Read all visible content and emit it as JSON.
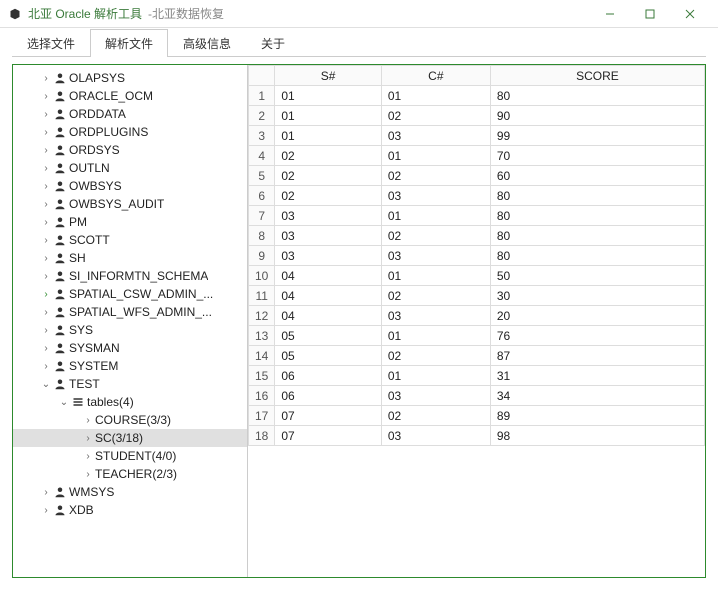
{
  "window": {
    "title": "北亚 Oracle 解析工具",
    "subtitle": "-北亚数据恢复"
  },
  "tabs": [
    {
      "label": "选择文件",
      "active": false
    },
    {
      "label": "解析文件",
      "active": true
    },
    {
      "label": "高级信息",
      "active": false
    },
    {
      "label": "关于",
      "active": false
    }
  ],
  "tree": [
    {
      "level": 1,
      "kind": "user",
      "expanded": false,
      "label": "OLAPSYS"
    },
    {
      "level": 1,
      "kind": "user",
      "expanded": false,
      "label": "ORACLE_OCM"
    },
    {
      "level": 1,
      "kind": "user",
      "expanded": false,
      "label": "ORDDATA"
    },
    {
      "level": 1,
      "kind": "user",
      "expanded": false,
      "label": "ORDPLUGINS"
    },
    {
      "level": 1,
      "kind": "user",
      "expanded": false,
      "label": "ORDSYS"
    },
    {
      "level": 1,
      "kind": "user",
      "expanded": false,
      "label": "OUTLN"
    },
    {
      "level": 1,
      "kind": "user",
      "expanded": false,
      "label": "OWBSYS"
    },
    {
      "level": 1,
      "kind": "user",
      "expanded": false,
      "label": "OWBSYS_AUDIT"
    },
    {
      "level": 1,
      "kind": "user",
      "expanded": false,
      "label": "PM"
    },
    {
      "level": 1,
      "kind": "user",
      "expanded": false,
      "label": "SCOTT"
    },
    {
      "level": 1,
      "kind": "user",
      "expanded": false,
      "label": "SH"
    },
    {
      "level": 1,
      "kind": "user",
      "expanded": false,
      "label": "SI_INFORMTN_SCHEMA"
    },
    {
      "level": 1,
      "kind": "user",
      "expanded": false,
      "label": "SPATIAL_CSW_ADMIN_...",
      "highlight": true
    },
    {
      "level": 1,
      "kind": "user",
      "expanded": false,
      "label": "SPATIAL_WFS_ADMIN_..."
    },
    {
      "level": 1,
      "kind": "user",
      "expanded": false,
      "label": "SYS"
    },
    {
      "level": 1,
      "kind": "user",
      "expanded": false,
      "label": "SYSMAN"
    },
    {
      "level": 1,
      "kind": "user",
      "expanded": false,
      "label": "SYSTEM"
    },
    {
      "level": 1,
      "kind": "user",
      "expanded": true,
      "label": "TEST"
    },
    {
      "level": 2,
      "kind": "tables",
      "expanded": true,
      "label": "tables(4)"
    },
    {
      "level": 3,
      "kind": "table",
      "expanded": false,
      "label": "COURSE(3/3)"
    },
    {
      "level": 3,
      "kind": "table",
      "expanded": false,
      "label": "SC(3/18)",
      "selected": true
    },
    {
      "level": 3,
      "kind": "table",
      "expanded": false,
      "label": "STUDENT(4/0)"
    },
    {
      "level": 3,
      "kind": "table",
      "expanded": false,
      "label": "TEACHER(2/3)"
    },
    {
      "level": 1,
      "kind": "user",
      "expanded": false,
      "label": "WMSYS"
    },
    {
      "level": 1,
      "kind": "user",
      "expanded": false,
      "label": "XDB"
    }
  ],
  "table": {
    "columns": [
      "S#",
      "C#",
      "SCORE"
    ],
    "rows": [
      [
        "01",
        "01",
        "80"
      ],
      [
        "01",
        "02",
        "90"
      ],
      [
        "01",
        "03",
        "99"
      ],
      [
        "02",
        "01",
        "70"
      ],
      [
        "02",
        "02",
        "60"
      ],
      [
        "02",
        "03",
        "80"
      ],
      [
        "03",
        "01",
        "80"
      ],
      [
        "03",
        "02",
        "80"
      ],
      [
        "03",
        "03",
        "80"
      ],
      [
        "04",
        "01",
        "50"
      ],
      [
        "04",
        "02",
        "30"
      ],
      [
        "04",
        "03",
        "20"
      ],
      [
        "05",
        "01",
        "76"
      ],
      [
        "05",
        "02",
        "87"
      ],
      [
        "06",
        "01",
        "31"
      ],
      [
        "06",
        "03",
        "34"
      ],
      [
        "07",
        "02",
        "89"
      ],
      [
        "07",
        "03",
        "98"
      ]
    ]
  }
}
